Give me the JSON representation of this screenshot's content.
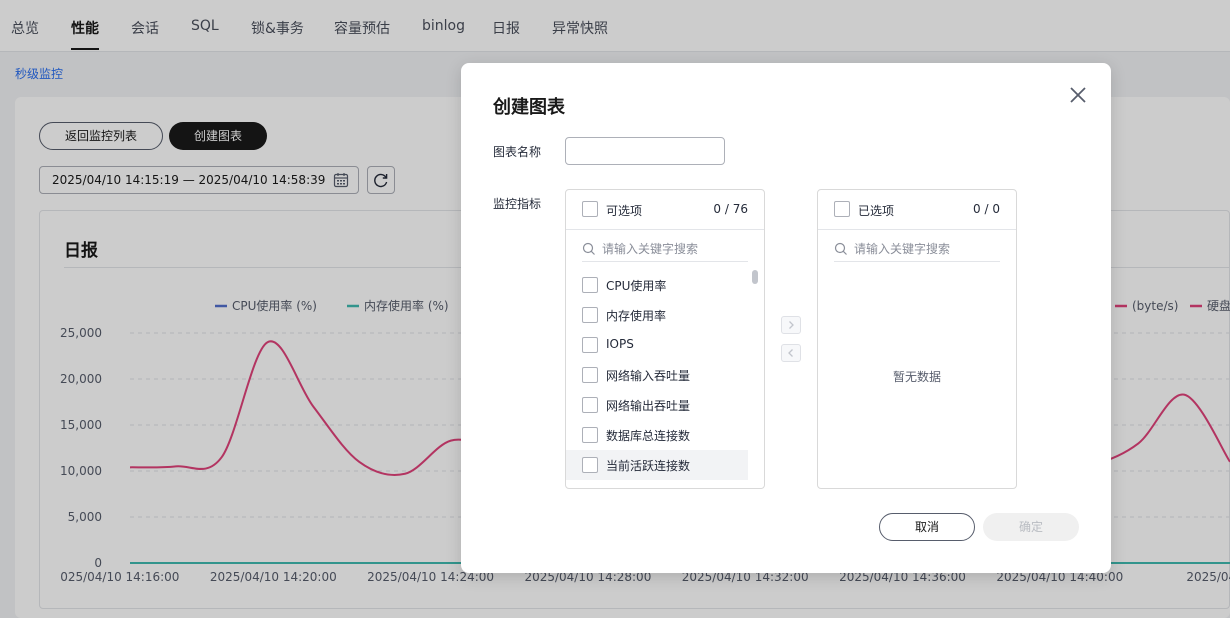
{
  "nav": {
    "tabs": [
      "总览",
      "性能",
      "会话",
      "SQL",
      "锁&事务",
      "容量预估",
      "binlog",
      "日报",
      "异常快照"
    ],
    "active_index": 1
  },
  "breadcrumb": "秒级监控",
  "toolbar": {
    "back_label": "返回监控列表",
    "create_label": "创建图表",
    "time_range": "2025/04/10 14:15:19 — 2025/04/10 14:58:39"
  },
  "chart_card": {
    "title": "日报"
  },
  "chart_data": {
    "type": "line",
    "series": [
      {
        "name": "CPU使用率 (%)",
        "color": "#526ecc",
        "values": [
          0,
          0,
          0,
          0,
          0,
          0,
          0,
          0,
          0,
          0,
          0,
          0,
          0,
          0,
          0,
          0,
          0,
          0,
          0,
          0,
          0,
          0,
          0,
          0,
          0
        ]
      },
      {
        "name": "内存使用率 (%)",
        "color": "#3fb9b0",
        "values": [
          0,
          0,
          0,
          0,
          0,
          0,
          0,
          0,
          0,
          0,
          0,
          0,
          0,
          0,
          0,
          0,
          0,
          0,
          0,
          0,
          0,
          0,
          0,
          0,
          0
        ]
      },
      {
        "name": "(byte/s)",
        "color": "#e0417a",
        "values": [
          10400,
          10500,
          11500,
          24000,
          17000,
          11000,
          9700,
          13300,
          12500,
          12700,
          15500,
          10100,
          10500,
          10600,
          10500,
          10600,
          10500,
          10600,
          10500,
          10600,
          10600,
          10700,
          13000,
          18300,
          11000
        ]
      },
      {
        "name": "硬盘",
        "color": "#e0417a",
        "values": []
      }
    ],
    "x_labels": [
      "2025/04/10 14:16:00",
      "2025/04/10 14:20:00",
      "2025/04/10 14:24:00",
      "2025/04/10 14:28:00",
      "2025/04/10 14:32:00",
      "2025/04/10 14:36:00",
      "2025/04/10 14:40:00",
      "2025/04/1"
    ],
    "y_ticks": [
      "25,000",
      "20,000",
      "15,000",
      "10,000",
      "5,000",
      "0"
    ],
    "ylim": [
      0,
      25000
    ],
    "grid": true,
    "legend": "top"
  },
  "modal": {
    "title": "创建图表",
    "name_label": "图表名称",
    "name_value": "",
    "metric_label": "监控指标",
    "source": {
      "title": "可选项",
      "count": "0 / 76",
      "search_placeholder": "请输入关键字搜索",
      "items": [
        "CPU使用率",
        "内存使用率",
        "IOPS",
        "网络输入吞吐量",
        "网络输出吞吐量",
        "数据库总连接数",
        "当前活跃连接数"
      ]
    },
    "target": {
      "title": "已选项",
      "count": "0 / 0",
      "search_placeholder": "请输入关键字搜索",
      "empty_text": "暂无数据"
    },
    "cancel_label": "取消",
    "confirm_label": "确定"
  }
}
